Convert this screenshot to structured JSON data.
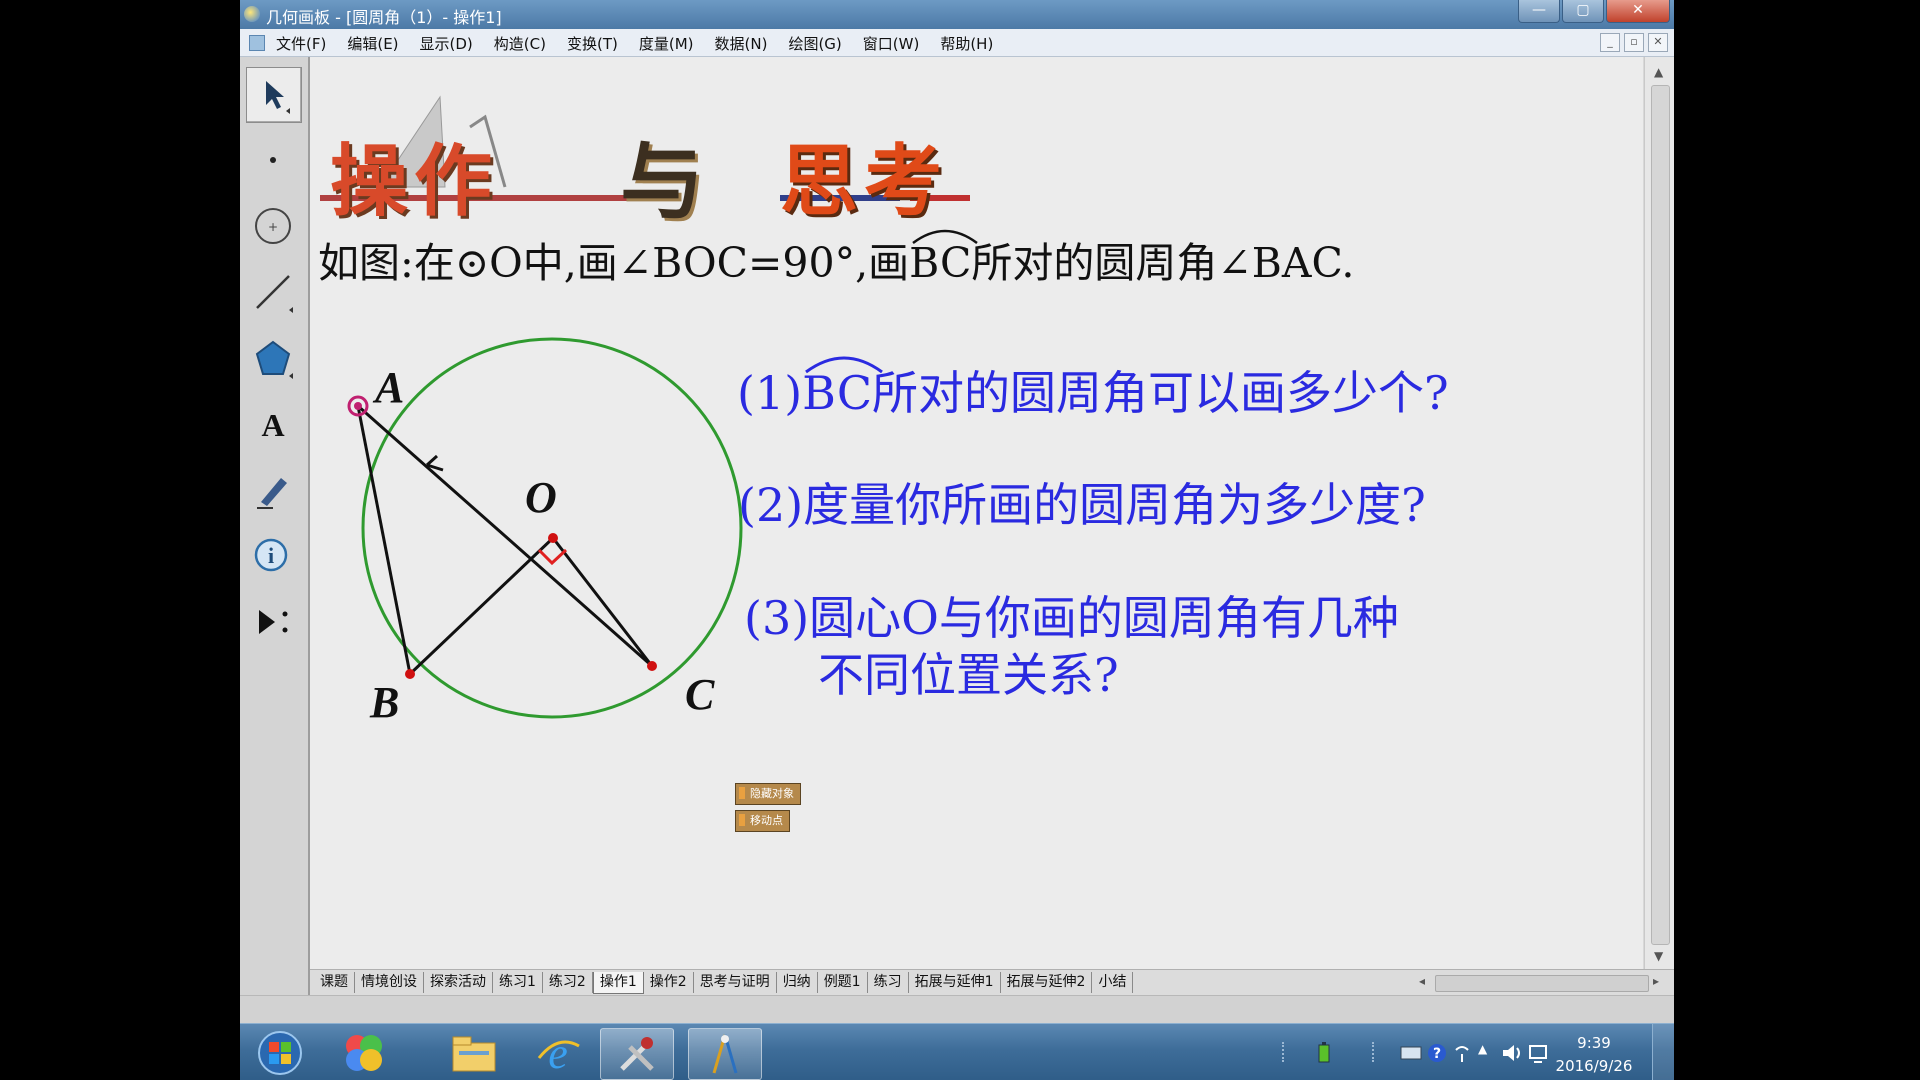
{
  "window": {
    "title": "几何画板 - [圆周角（1）- 操作1]",
    "controls": [
      "—",
      "▢",
      "✕"
    ]
  },
  "menu": [
    "文件(F)",
    "编辑(E)",
    "显示(D)",
    "构造(C)",
    "变换(T)",
    "度量(M)",
    "数据(N)",
    "绘图(G)",
    "窗口(W)",
    "帮助(H)"
  ],
  "mdi_controls": [
    "_",
    "▫",
    "✕"
  ],
  "tools": [
    "arrow-select-tool-icon",
    "point-tool-icon",
    "compass-tool-icon",
    "straightedge-tool-icon",
    "polygon-tool-icon",
    "text-tool-icon",
    "marker-tool-icon",
    "information-tool-icon",
    "custom-tool-icon"
  ],
  "banner": {
    "title_part1": "操作",
    "title_part2": "与",
    "title_part3": "思考"
  },
  "problem": {
    "prefix": "如图:在⊙O中,画∠BOC=90°,画",
    "arc": "BC",
    "suffix": "所对的圆周角∠BAC."
  },
  "questions": {
    "q1_prefix": "(1)",
    "q1_arc": "BC",
    "q1_text": "所对的圆周角可以画多少个?",
    "q2": "(2)度量你所画的圆周角为多少度?",
    "q3_line1": "(3)圆心O与你画的圆周角有几种",
    "q3_line2": "不同位置关系?"
  },
  "figure": {
    "labels": {
      "A": "A",
      "B": "B",
      "C": "C",
      "O": "O"
    },
    "circle_color": "#2f9a2f",
    "right_angle_color": "#e02020"
  },
  "buttons": {
    "hide_objects": "隐藏对象",
    "move_point": "移动点"
  },
  "page_tabs": [
    "课题",
    "情境创设",
    "探索活动",
    "练习1",
    "练习2",
    "操作1",
    "操作2",
    "思考与证明",
    "归纳",
    "例题1",
    "练习",
    "拓展与延伸1",
    "拓展与延伸2",
    "小结"
  ],
  "active_tab": "操作1",
  "taskbar": {
    "items": [
      "start-orb-icon",
      "colorful-app-icon",
      "file-explorer-icon",
      "internet-explorer-icon",
      "tools-icon",
      "geometers-sketchpad-icon"
    ],
    "time": "9:39",
    "date": "2016/9/26"
  },
  "colors": {
    "question_text": "#2a2ae0",
    "title_bar": "#5a87b3",
    "canvas": "#ececec"
  }
}
